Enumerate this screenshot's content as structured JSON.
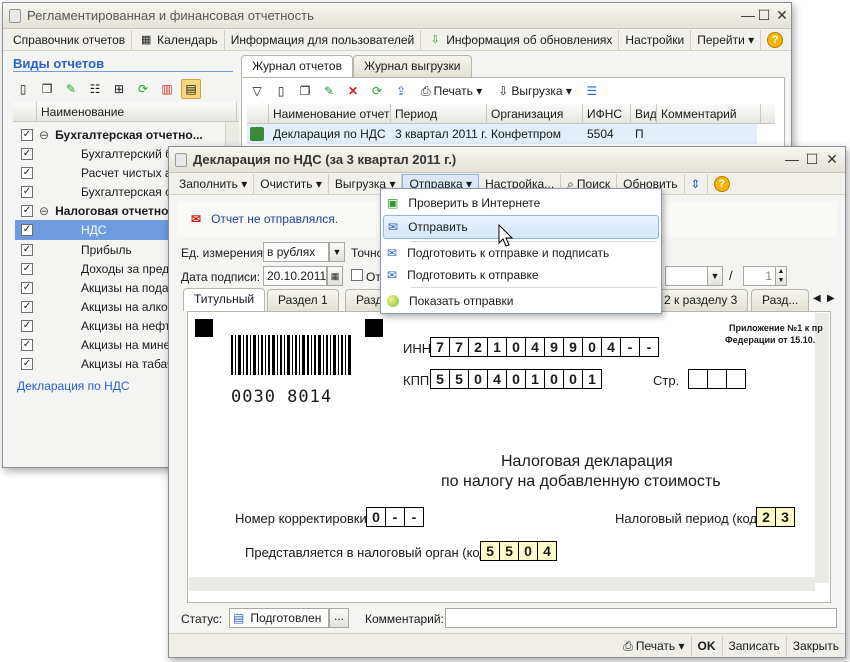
{
  "back_window": {
    "title": "Регламентированная и финансовая отчетность",
    "menu": [
      "Справочник отчетов",
      "Календарь",
      "Информация для пользователей",
      "Информация об обновлениях",
      "Настройки",
      "Перейти ▾"
    ],
    "left_panel": {
      "heading": "Виды отчетов",
      "column_header": "Наименование",
      "tree": [
        {
          "label": "Бухгалтерская отчетно...",
          "group": true,
          "checked": true
        },
        {
          "label": "Бухгалтерский ба",
          "group": false,
          "checked": true
        },
        {
          "label": "Расчет чистых акт",
          "group": false,
          "checked": true
        },
        {
          "label": "Бухгалтерская от",
          "group": false,
          "checked": true
        },
        {
          "label": "Налоговая отчетно",
          "group": true,
          "checked": true
        },
        {
          "label": "НДС",
          "group": false,
          "checked": true,
          "selected": true
        },
        {
          "label": "Прибыль",
          "group": false,
          "checked": true
        },
        {
          "label": "Доходы за преде...",
          "group": false,
          "checked": true
        },
        {
          "label": "Акцизы на подак",
          "group": false,
          "checked": true
        },
        {
          "label": "Акцизы на алког",
          "group": false,
          "checked": true
        },
        {
          "label": "Акцизы на нефте",
          "group": false,
          "checked": true
        },
        {
          "label": "Акцизы на минер",
          "group": false,
          "checked": true
        },
        {
          "label": "Акцизы на табачн",
          "group": false,
          "checked": true
        }
      ],
      "link": "Декларация по НДС"
    },
    "tabs": [
      "Журнал отчетов",
      "Журнал выгрузки"
    ],
    "toolbar": {
      "print": "Печать ▾",
      "export": "Выгрузка ▾"
    },
    "journal_headers": [
      "Наименование отчета",
      "Период",
      "Организация",
      "ИФНС",
      "Вид",
      "Комментарий"
    ],
    "journal_row": [
      "Декларация по НДС",
      "3 квартал 2011 г.",
      "Конфетпром",
      "5504",
      "П",
      ""
    ]
  },
  "front_window": {
    "title": "Декларация по НДС (за 3 квартал 2011 г.)",
    "menu": [
      "Заполнить ▾",
      "Очистить ▾",
      "Выгрузка ▾",
      "Отправка ▾",
      "Настройка...",
      "Поиск",
      "Обновить"
    ],
    "notice": "Отчет не отправлялся.",
    "units_label": "Ед. измерения:",
    "units_value": "в рублях",
    "precision_label": "Точно",
    "date_label": "Дата подписи:",
    "date_value": "20.10.2011",
    "checkbox_label": "От",
    "page_sep": "/",
    "page_value": "1",
    "tabs": [
      "Титульный",
      "Раздел 1",
      "Разд",
      "2 к разделу 3",
      "Разд..."
    ],
    "form": {
      "barcode_number": "0030 8014",
      "inn_label": "ИНН",
      "inn": [
        "7",
        "7",
        "2",
        "1",
        "0",
        "4",
        "9",
        "9",
        "0",
        "4",
        "-",
        "-"
      ],
      "kpp_label": "КПП",
      "kpp": [
        "5",
        "5",
        "0",
        "4",
        "0",
        "1",
        "0",
        "0",
        "1"
      ],
      "page_label": "Стр.",
      "appendix_line1": "Приложение №1 к пр",
      "appendix_line2": "Федерации от 15.10.",
      "title_line1": "Налоговая декларация",
      "title_line2": "по налогу на добавленную стоимость",
      "correction_label": "Номер корректировки",
      "correction": [
        "0",
        "-",
        "-"
      ],
      "period_label": "Налоговый период (код)",
      "period": [
        "2",
        "3"
      ],
      "authority_label": "Представляется в налоговый орган (код)",
      "authority": [
        "5",
        "5",
        "0",
        "4"
      ]
    },
    "status_label": "Статус:",
    "status_value": "Подготовлен",
    "status_btn": "...",
    "comment_label": "Комментарий:",
    "bottom": {
      "print": "Печать ▾",
      "ok": "OK",
      "save": "Записать",
      "close": "Закрыть"
    }
  },
  "dropdown": {
    "items": [
      "Проверить в Интернете",
      "Отправить",
      "Подготовить к отправке и подписать",
      "Подготовить к отправке",
      "Показать отправки"
    ],
    "highlighted": "Отправить"
  },
  "colors": {
    "selection": "#6f9be0",
    "tab_journal_active": "#ffffff",
    "notice_text": "#1f3f9f",
    "link": "#2a62c9"
  }
}
